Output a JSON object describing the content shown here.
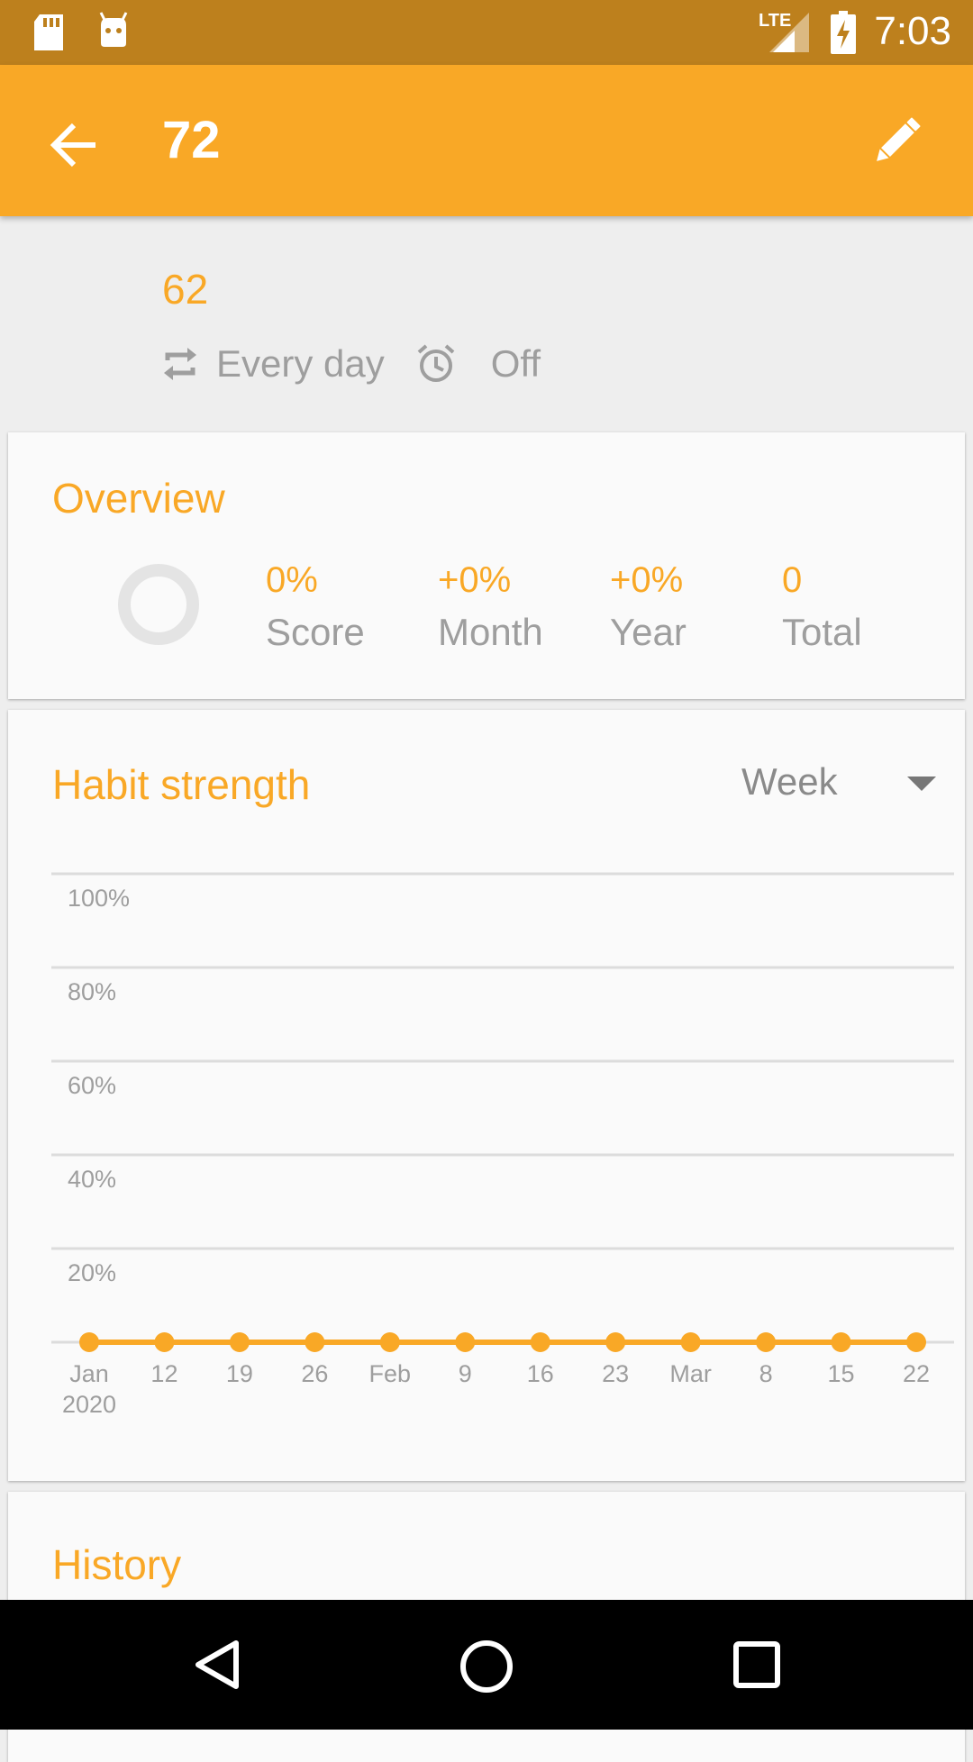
{
  "status_bar": {
    "time": "7:03",
    "network": "LTE",
    "icons": [
      "sd-card-icon",
      "android-icon",
      "signal-icon",
      "battery-charging-icon"
    ]
  },
  "app_bar": {
    "title": "72",
    "back_icon": "arrow-back-icon",
    "edit_icon": "pencil-icon"
  },
  "habit_header": {
    "question": "62",
    "frequency": "Every day",
    "reminder": "Off"
  },
  "overview": {
    "title": "Overview",
    "stats": [
      {
        "value": "0%",
        "label": "Score"
      },
      {
        "value": "+0%",
        "label": "Month"
      },
      {
        "value": "+0%",
        "label": "Year"
      },
      {
        "value": "0",
        "label": "Total"
      }
    ]
  },
  "habit_strength": {
    "title": "Habit strength",
    "period": "Week"
  },
  "chart_data": {
    "type": "line",
    "title": "",
    "x": [
      "Jan\n2020",
      "12",
      "19",
      "26",
      "Feb",
      "9",
      "16",
      "23",
      "Mar",
      "8",
      "15",
      "22"
    ],
    "series": [
      {
        "values": [
          0,
          0,
          0,
          0,
          0,
          0,
          0,
          0,
          0,
          0,
          0,
          0
        ]
      }
    ],
    "y_ticks": [
      "100%",
      "80%",
      "60%",
      "40%",
      "20%"
    ],
    "ylim": [
      0,
      100
    ],
    "grid": true,
    "color": "#f9a826"
  },
  "history": {
    "title": "History"
  },
  "colors": {
    "accent": "#f9a826",
    "status_bar": "#bd801d",
    "secondary_text": "#9e9e9e"
  }
}
